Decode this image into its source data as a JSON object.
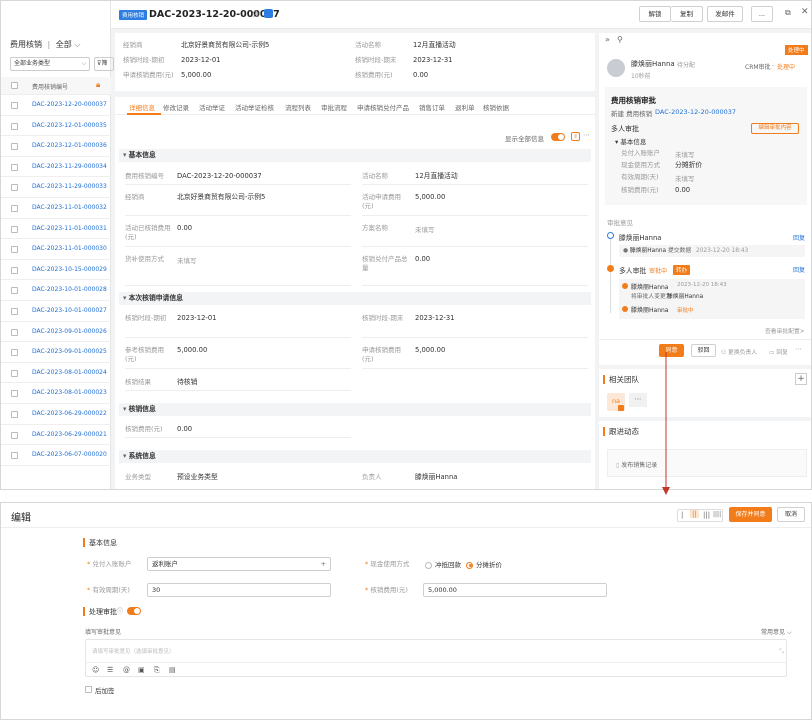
{
  "left": {
    "title": "费用核销",
    "filter": "全部",
    "select": "全部业务类型",
    "filter_btn": "筛",
    "col_header": "费用核销编号",
    "rows": [
      "DAC-2023-12-20-000037",
      "DAC-2023-12-01-000035",
      "DAC-2023-12-01-000036",
      "DAC-2023-11-29-000034",
      "DAC-2023-11-29-000033",
      "DAC-2023-11-01-000032",
      "DAC-2023-11-01-000031",
      "DAC-2023-11-01-000030",
      "DAC-2023-10-15-000029",
      "DAC-2023-10-01-000028",
      "DAC-2023-10-01-000027",
      "DAC-2023-09-01-000026",
      "DAC-2023-09-01-000025",
      "DAC-2023-08-01-000024",
      "DAC-2023-08-01-000023",
      "DAC-2023-06-29-000022",
      "DAC-2023-06-29-000021",
      "DAC-2023-06-07-000020"
    ]
  },
  "header": {
    "tag": "费用核销",
    "title": "DAC-2023-12-20-000037",
    "btn_unlock": "解锁",
    "btn_copy": "复制",
    "btn_send": "发邮件",
    "btn_more": "..."
  },
  "summary": {
    "f1_label": "经销商",
    "f1_value": "北京好景商贸有限公司-示例5",
    "f2_label": "活动名称",
    "f2_value": "12月直播活动",
    "f3_label": "核销时段-期初",
    "f3_value": "2023-12-01",
    "f4_label": "核销时段-期末",
    "f4_value": "2023-12-31",
    "f5_label": "申请核销费用(元)",
    "f5_value": "5,000.00",
    "f6_label": "核销费用(元)",
    "f6_value": "0.00"
  },
  "tabs": [
    "详细信息",
    "修改记录",
    "活动举证",
    "活动举证检核",
    "流程列表",
    "审批流程",
    "申请核销兑付产品",
    "销售订单",
    "退利单",
    "核销依据"
  ],
  "show_all": "显示全部信息",
  "basic": {
    "title": "基本信息",
    "r1a_l": "费用核销编号",
    "r1a_v": "DAC-2023-12-20-000037",
    "r1b_l": "活动名称",
    "r1b_v": "12月直播活动",
    "r2a_l": "经销商",
    "r2a_v": "北京好景商贸有限公司-示例5",
    "r2b_l": "活动申请费用(元)",
    "r2b_v": "5,000.00",
    "r3a_l": "活动已核销费用(元)",
    "r3a_v": "0.00",
    "r3b_l": "方案名称",
    "r3b_v": "未填写",
    "r4a_l": "货补使用方式",
    "r4a_v": "未填写",
    "r4b_l": "核销兑付产品总量",
    "r4b_v": "0.00"
  },
  "apply": {
    "title": "本次核销申请信息",
    "r1a_l": "核销时段-期初",
    "r1a_v": "2023-12-01",
    "r1b_l": "核销时段-期末",
    "r1b_v": "2023-12-31",
    "r2a_l": "参考核销费用(元)",
    "r2a_v": "5,000.00",
    "r2b_l": "申请核销费用(元)",
    "r2b_v": "5,000.00",
    "r3a_l": "核销结果",
    "r3a_v": "待核销"
  },
  "writeoff": {
    "title": "核销信息",
    "r1_l": "核销费用(元)",
    "r1_v": "0.00"
  },
  "system": {
    "title": "系统信息",
    "r1a_l": "业务类型",
    "r1a_v": "预设业务类型",
    "r1b_l": "负责人",
    "r1b_v": "滕焕丽Hanna"
  },
  "right": {
    "status_badge": "处理中",
    "user": "滕焕丽Hanna",
    "user_tag": "待分配",
    "user_time": "10秒前",
    "crm": "CRM审批",
    "crm_status": "处理中",
    "approval_title": "费用核销审批",
    "new_prefix": "新建 费用核销",
    "new_id": "DAC-2023-12-20-000037",
    "multi": "多人审批",
    "edit_btn": "编辑审批内容",
    "basic": "基本信息",
    "k1": "兑付入账账户",
    "v1": "未填写",
    "k2": "现金使用方式",
    "v2": "分摊折价",
    "k3": "有效周期(天)",
    "v3": "未填写",
    "k4": "核销费用(元)",
    "v4": "0.00",
    "opinion": "审批意见",
    "node1": "滕焕丽Hanna",
    "reply": "回复",
    "submit_user": "滕焕丽Hanna",
    "submit_text": "提交数据",
    "submit_time": "2023-12-20 18:43",
    "multi2": "多人审批",
    "multi2_status": "审批中",
    "multi2_tag": "转办",
    "reply2": "回复",
    "sub1_user": "滕焕丽Hanna",
    "sub1_time": "2023-12-20 18:43",
    "sub1_text": "将审批人变更为",
    "sub1_to": "滕焕丽Hanna",
    "sub2_user": "滕焕丽Hanna",
    "sub2_status": "审批中",
    "more_config": "查看审批配置>",
    "btn_agree": "同意",
    "btn_reject": "驳回",
    "btn_change": "更换负责人",
    "btn_return": "回复",
    "team_title": "相关团队",
    "team_member": "na",
    "follow_title": "跟进动态",
    "publish": "发布销售记录"
  },
  "edit": {
    "title": "编辑",
    "save_approve": "保存并同意",
    "cancel": "取消",
    "section": "基本信息",
    "f1_label": "兑付入账账户",
    "f1_value": "返利账户",
    "f2_label": "现金使用方式",
    "f2_opt1": "冲抵回款",
    "f2_opt2": "分摊折价",
    "f3_label": "有效周期(天)",
    "f3_value": "30",
    "f4_label": "核销费用(元)",
    "f4_value": "5,000.00",
    "process_label": "处理审批",
    "opinion_label": "填写审批意见",
    "common_opinion": "常用意见",
    "placeholder": "请填写审批意见（选填审批意见）",
    "countersign": "后加签"
  }
}
